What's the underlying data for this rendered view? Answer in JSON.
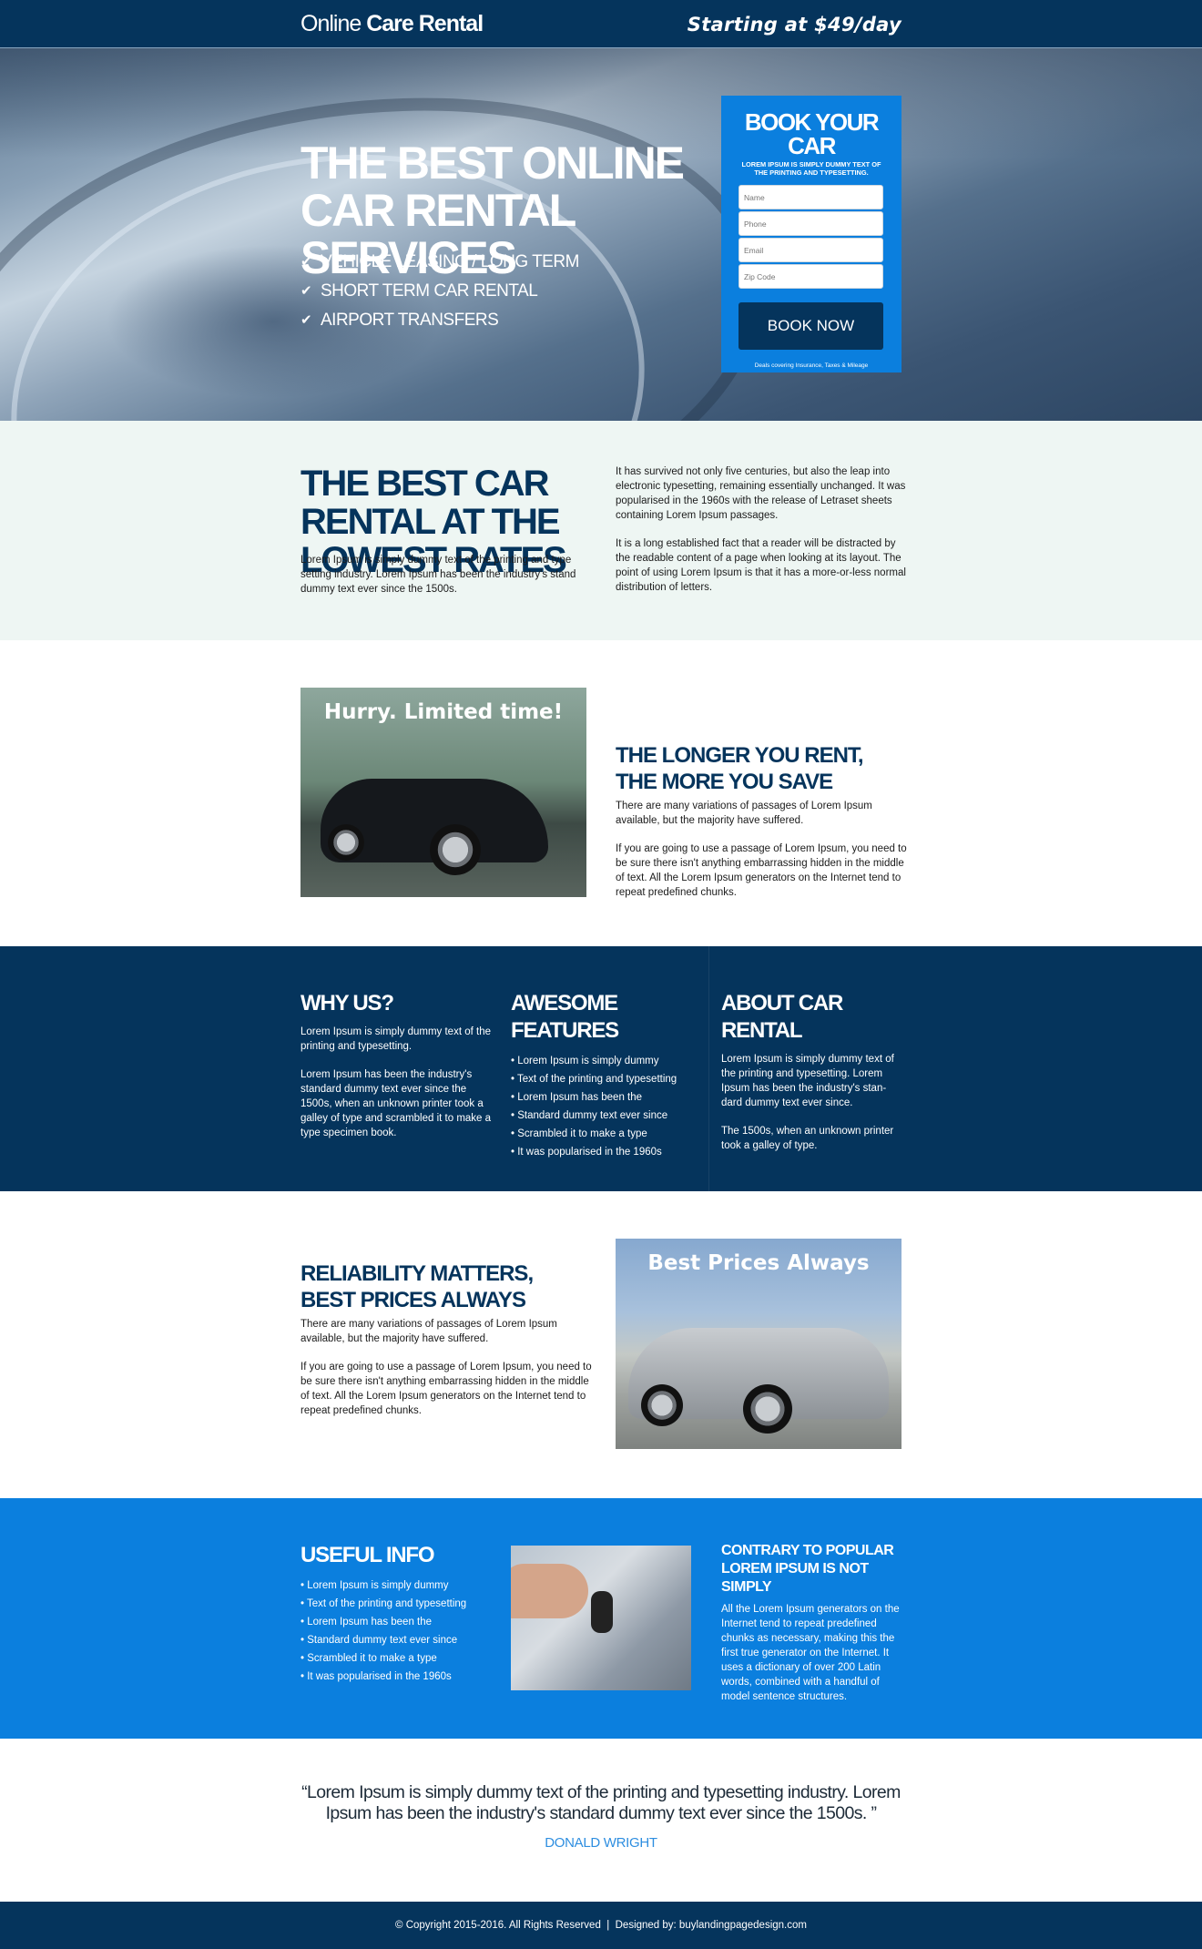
{
  "header": {
    "logo_prefix": "Online",
    "logo_bold": "Care Rental",
    "price": "Starting at $49/day"
  },
  "hero": {
    "title": "THE BEST ONLINE CAR RENTAL SERVICES",
    "features": [
      "VEHICLE LEASING / LONG TERM",
      "SHORT TERM CAR RENTAL",
      "AIRPORT TRANSFERS"
    ],
    "form": {
      "title": "BOOK YOUR CAR",
      "subtitle": "LOREM IPSUM IS SIMPLY DUMMY TEXT OF THE PRINTING AND TYPESETTING.",
      "name_placeholder": "Name",
      "phone_placeholder": "Phone",
      "email_placeholder": "Email",
      "zip_placeholder": "Zip Code",
      "button": "BOOK NOW",
      "note": "Deals covering Insurance, Taxes & Mileage"
    }
  },
  "intro": {
    "title": "THE BEST CAR RENTAL AT THE LOWEST RATES",
    "left_text": "Lorem Ipsum is simply dummy text of the printing and type setting industry. Lorem Ipsum has been the industry's stand dummy text ever since the 1500s.",
    "right_p1": "It has survived not only five centuries, but also the leap into electronic typesetting, remaining essentially unchanged. It was popularised in the 1960s with the release of Letraset sheets containing Lorem Ipsum passages.",
    "right_p2": "It is a long established fact that a reader will be distracted by the readable content of a page when looking at its layout. The point of using Lorem Ipsum is that it has a more-or-less normal distribution of letters."
  },
  "longer": {
    "image_caption": "Hurry. Limited time!",
    "title": "THE LONGER YOU RENT, THE MORE YOU SAVE",
    "p1": "There are many variations of passages of Lorem Ipsum available, but the majority have suffered.",
    "p2": "If you are going to use a passage of Lorem Ipsum, you need to be sure there isn't anything embarrassing hidden in the middle of text. All the Lorem Ipsum generators on the Internet tend to repeat predefined chunks."
  },
  "columns": {
    "why": {
      "title": "WHY US?",
      "p1": "Lorem Ipsum is simply dummy text of the printing and typesetting.",
      "p2": "Lorem Ipsum has been the industry's standard dummy text ever since the 1500s, when an unknown printer took a galley of type and scrambled it to make a type specimen book."
    },
    "features": {
      "title": "AWESOME FEATURES",
      "items": [
        "• Lorem Ipsum is simply dummy",
        "• Text of the printing and typesetting",
        "• Lorem Ipsum has been the",
        "• Standard dummy text ever since",
        "• Scrambled it to make a type",
        "• It was popularised in the 1960s"
      ]
    },
    "about": {
      "title": "ABOUT CAR RENTAL",
      "p1": "Lorem Ipsum is simply dummy text of the printing and typesetting. Lorem Ipsum has been the industry's stan-dard dummy text ever since.",
      "p2": "The 1500s, when an unknown printer took a galley of type."
    }
  },
  "reliability": {
    "title": "RELIABILITY MATTERS, BEST PRICES ALWAYS",
    "p1": "There are many variations of passages of Lorem Ipsum available, but the majority have suffered.",
    "p2": "If you are going to use a passage of Lorem Ipsum, you need to be sure there isn't anything embarrassing hidden in the middle of text. All the Lorem Ipsum generators on the Internet tend to repeat predefined chunks.",
    "image_caption": "Best Prices Always"
  },
  "useful": {
    "title": "USEFUL INFO",
    "items": [
      "• Lorem Ipsum is simply dummy",
      "• Text of the printing and typesetting",
      "• Lorem Ipsum has been the",
      "• Standard dummy text ever since",
      "• Scrambled it to make a type",
      "• It was popularised in the 1960s"
    ],
    "col3_title": "CONTRARY TO POPULAR LOREM IPSUM IS NOT SIMPLY",
    "col3_text": "All the Lorem Ipsum generators on the Internet tend to repeat predefined chunks as necessary, making this the first true generator on the Internet. It uses a dictionary of over 200 Latin words, combined with a handful of model sentence structures."
  },
  "testimonial": {
    "quote": "“Lorem Ipsum is simply dummy text of the printing and typesetting industry. Lorem Ipsum has been the industry's standard dummy text ever since the 1500s. ”",
    "author": "DONALD WRIGHT"
  },
  "footer": {
    "text": "© Copyright 2015-2016. All Rights Reserved  |  Designed by: buylandingpagedesign.com"
  },
  "colors": {
    "navy": "#05345c",
    "blue": "#0b7fde",
    "light_bg": "#eef6f3",
    "author": "#2e8ee0"
  }
}
